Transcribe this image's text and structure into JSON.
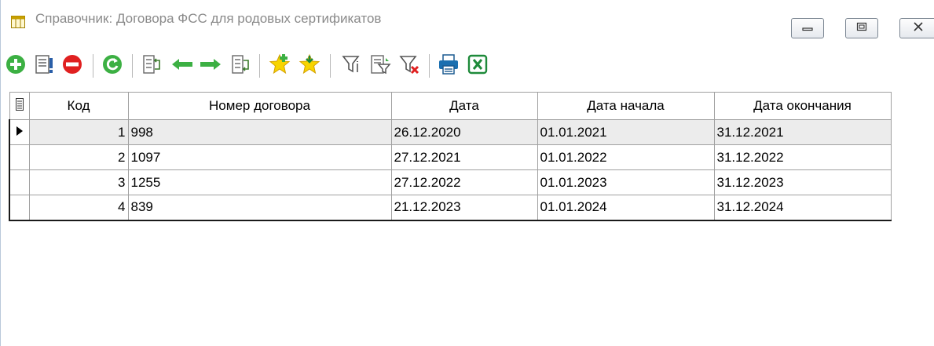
{
  "window": {
    "title": "Справочник: Договора ФСС для родовых сертификатов"
  },
  "toolbar": {
    "buttons": [
      {
        "icon": "add-icon",
        "color": "#3cb043"
      },
      {
        "icon": "edit-icon",
        "color": "#555555"
      },
      {
        "icon": "delete-icon",
        "color": "#e02020"
      },
      {
        "icon": "refresh-icon",
        "color": "#3cb043"
      },
      {
        "icon": "column-settings-icon",
        "color": "#3a7a2a"
      },
      {
        "icon": "arrow-left-icon",
        "color": "#3cb043"
      },
      {
        "icon": "arrow-right-icon",
        "color": "#3cb043"
      },
      {
        "icon": "column-export-icon",
        "color": "#3a7a2a"
      },
      {
        "icon": "favorite-add-icon",
        "color": "#f2c200"
      },
      {
        "icon": "favorite-select-icon",
        "color": "#f2c200"
      },
      {
        "icon": "filter-icon",
        "color": "#555555"
      },
      {
        "icon": "filter-edit-icon",
        "color": "#555555"
      },
      {
        "icon": "filter-clear-icon",
        "color": "#e02020"
      },
      {
        "icon": "print-icon",
        "color": "#1a6fb0"
      },
      {
        "icon": "excel-icon",
        "color": "#1e8a3a"
      }
    ]
  },
  "grid": {
    "columns": [
      "Код",
      "Номер договора",
      "Дата",
      "Дата начала",
      "Дата окончания"
    ],
    "rows": [
      {
        "code": "1",
        "number": "998",
        "date": "26.12.2020",
        "start": "01.01.2021",
        "end": "31.12.2021"
      },
      {
        "code": "2",
        "number": "1097",
        "date": "27.12.2021",
        "start": "01.01.2022",
        "end": "31.12.2022"
      },
      {
        "code": "3",
        "number": "1255",
        "date": "27.12.2022",
        "start": "01.01.2023",
        "end": "31.12.2023"
      },
      {
        "code": "4",
        "number": "839",
        "date": "21.12.2023",
        "start": "01.01.2024",
        "end": "31.12.2024"
      }
    ],
    "current_row": 0
  },
  "colors": {
    "accent_green": "#3cb043",
    "selected_row_bg": "#ececec",
    "title_text": "#8a8a8a"
  }
}
